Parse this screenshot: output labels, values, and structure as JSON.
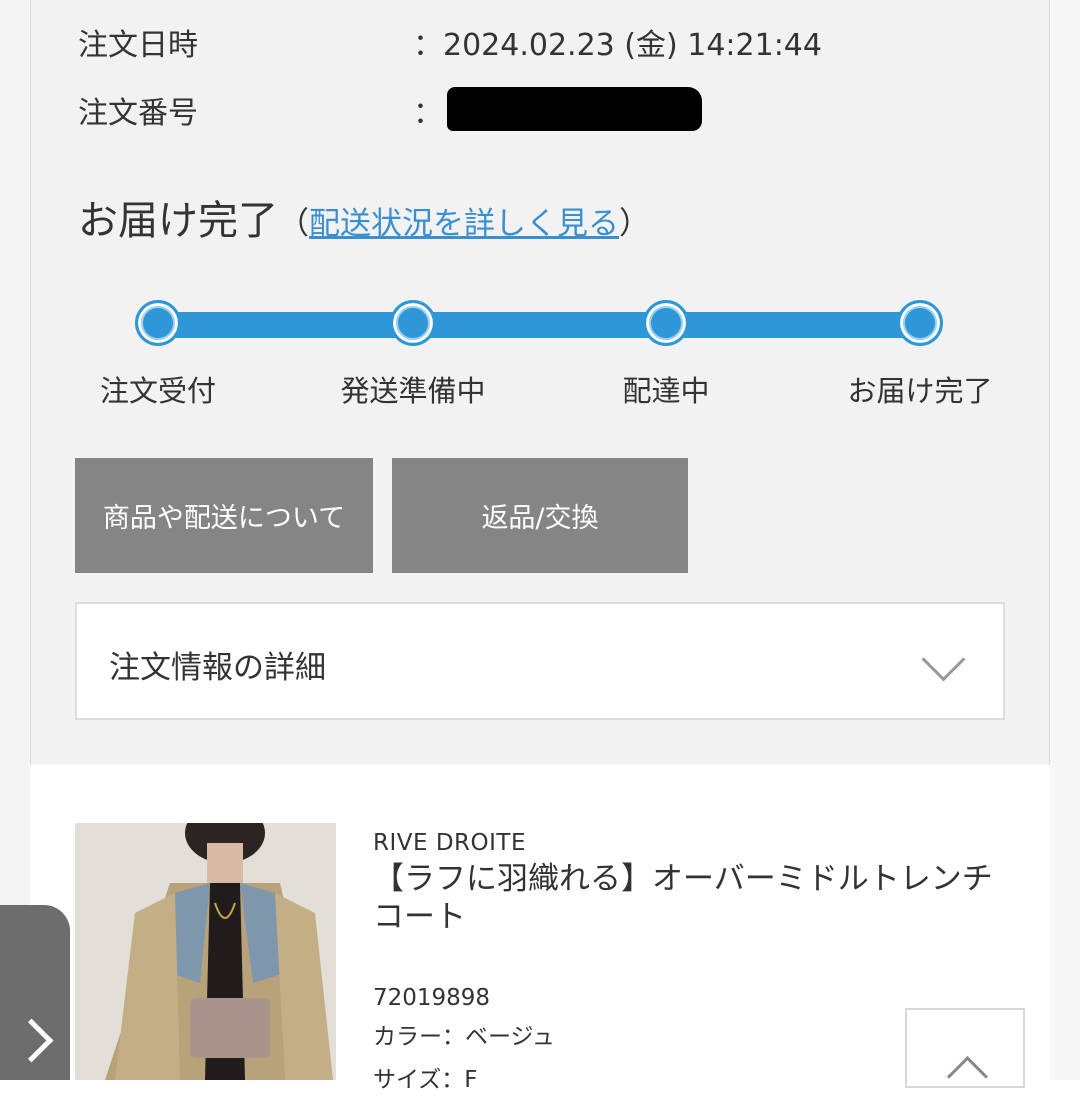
{
  "order": {
    "date_label": "注文日時",
    "date_value": "：2024.02.23 (金) 14:21:44",
    "number_label": "注文番号",
    "number_prefix": "："
  },
  "status": {
    "title": "お届け完了",
    "paren_open": "（",
    "link_label": "配送状況を詳しく見る",
    "paren_close": "）",
    "accent": "#2d97d8",
    "steps": [
      "注文受付",
      "発送準備中",
      "配達中",
      "お届け完了"
    ]
  },
  "actions": {
    "about_label": "商品や配送について",
    "return_label": "返品/交換"
  },
  "details": {
    "label": "注文情報の詳細"
  },
  "product": {
    "brand": "RIVE DROITE",
    "name": "【ラフに羽織れる】オーバーミドルトレンチコート",
    "code": "72019898",
    "color": "カラー：ベージュ",
    "size": "サイズ：F"
  }
}
